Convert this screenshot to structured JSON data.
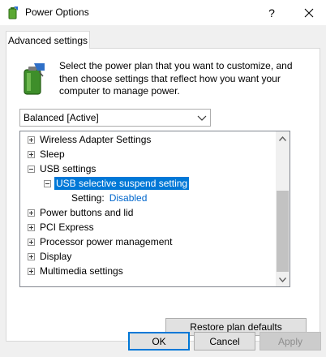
{
  "window": {
    "title": "Power Options",
    "help_glyph": "?",
    "close_icon": "close-icon"
  },
  "tab": {
    "label": "Advanced settings"
  },
  "header": {
    "description": "Select the power plan that you want to customize, and then choose settings that reflect how you want your computer to manage power.",
    "icon": "battery-power-icon"
  },
  "plan_select": {
    "value": "Balanced [Active]"
  },
  "tree": {
    "items": [
      {
        "label": "Wireless Adapter Settings",
        "state": "collapsed"
      },
      {
        "label": "Sleep",
        "state": "collapsed"
      },
      {
        "label": "USB settings",
        "state": "expanded"
      },
      {
        "label": "USB selective suspend setting",
        "state": "expanded",
        "selected": true
      },
      {
        "label": "Setting:",
        "value": "Disabled"
      },
      {
        "label": "Power buttons and lid",
        "state": "collapsed"
      },
      {
        "label": "PCI Express",
        "state": "collapsed"
      },
      {
        "label": "Processor power management",
        "state": "collapsed"
      },
      {
        "label": "Display",
        "state": "collapsed"
      },
      {
        "label": "Multimedia settings",
        "state": "collapsed"
      }
    ]
  },
  "buttons": {
    "restore": "Restore plan defaults",
    "ok": "OK",
    "cancel": "Cancel",
    "apply": "Apply"
  },
  "colors": {
    "selection": "#0078d7",
    "setting_value": "#0066cc",
    "default_button_border": "#0078d7"
  }
}
